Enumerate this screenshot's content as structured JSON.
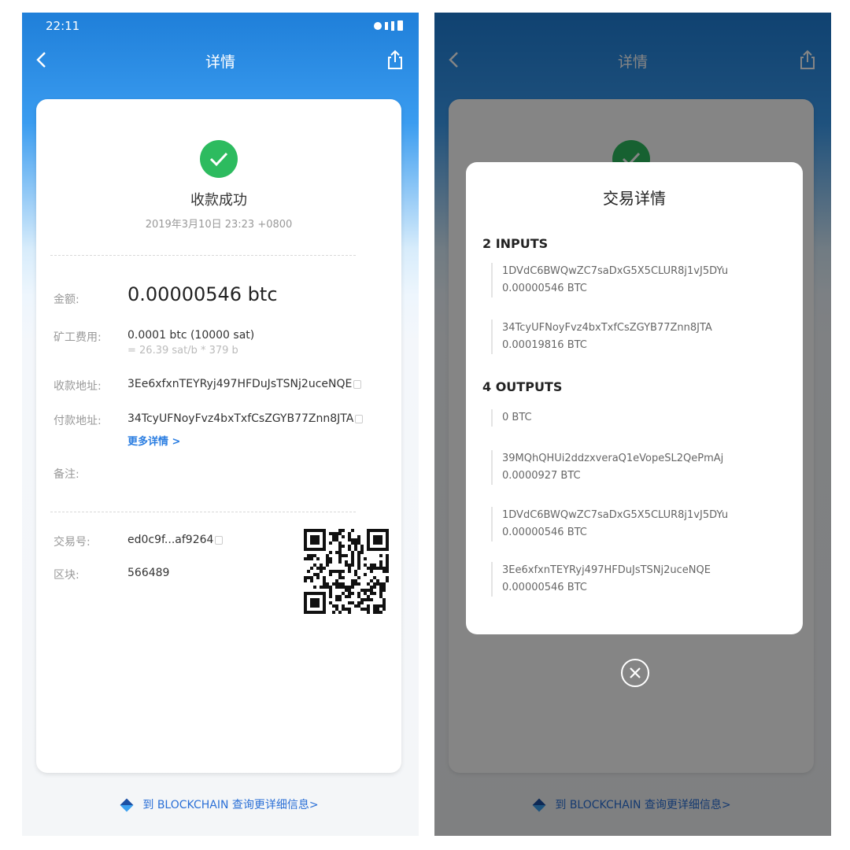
{
  "status": {
    "time": "22:11"
  },
  "header": {
    "title": "详情"
  },
  "detail": {
    "status_title": "收款成功",
    "timestamp": "2019年3月10日 23:23 +0800",
    "amount_label": "金额:",
    "amount_value": "0.00000546 btc",
    "fee_label": "矿工费用:",
    "fee_value": "0.0001 btc (10000 sat)",
    "fee_rate": "= 26.39 sat/b * 379 b",
    "receive_label": "收款地址:",
    "receive_value": "3Ee6xfxnTEYRyj497HFDuJsTSNj2uceNQE",
    "pay_label": "付款地址:",
    "pay_value": "34TcyUFNoyFvz4bxTxfCsZGYB77Znn8JTA",
    "more_link": "更多详情 >",
    "note_label": "备注:",
    "txid_label": "交易号:",
    "txid_value": "ed0c9f...af9264",
    "block_label": "区块:",
    "block_value": "566489"
  },
  "footer": {
    "link": "到 BLOCKCHAIN 查询更详细信息>"
  },
  "modal": {
    "title": "交易详情",
    "inputs_title": "2 INPUTS",
    "inputs": [
      {
        "address": "1DVdC6BWQwZC7saDxG5X5CLUR8j1vJ5DYu",
        "amount": "0.00000546 BTC"
      },
      {
        "address": "34TcyUFNoyFvz4bxTxfCsZGYB77Znn8JTA",
        "amount": "0.00019816 BTC"
      }
    ],
    "outputs_title": "4 OUTPUTS",
    "outputs": [
      {
        "address": "",
        "amount": "0 BTC"
      },
      {
        "address": "39MQhQHUi2ddzxveraQ1eVopeSL2QePmAj",
        "amount": "0.0000927 BTC"
      },
      {
        "address": "1DVdC6BWQwZC7saDxG5X5CLUR8j1vJ5DYu",
        "amount": "0.00000546 BTC"
      },
      {
        "address": "3Ee6xfxnTEYRyj497HFDuJsTSNj2uceNQE",
        "amount": "0.00000546 BTC"
      }
    ]
  },
  "icons": {
    "back": "chevron-left-icon",
    "share": "share-icon",
    "success": "check-circle-icon",
    "copy": "copy-icon",
    "qr": "qr-code-icon",
    "blockchain": "blockchain-logo-icon",
    "close": "close-circle-icon"
  },
  "colors": {
    "header_blue": "#2f8fe8",
    "success_green": "#2dbb5f",
    "link_blue": "#2a7de1"
  }
}
